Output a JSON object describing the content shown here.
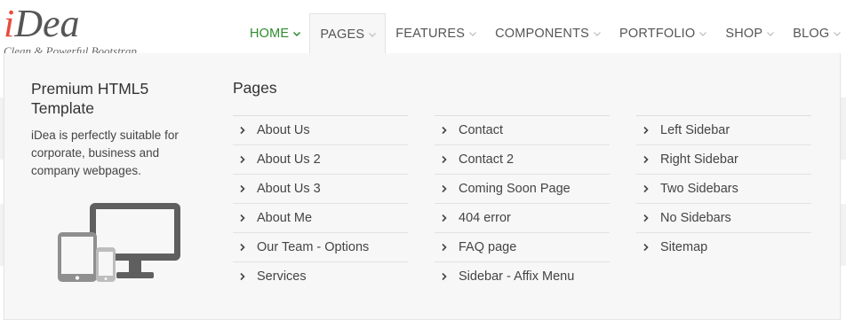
{
  "header": {
    "logo_first": "i",
    "logo_rest": "Dea",
    "tagline": "Clean & Powerful Bootstrap"
  },
  "nav": {
    "items": [
      {
        "label": "HOME"
      },
      {
        "label": "PAGES"
      },
      {
        "label": "FEATURES"
      },
      {
        "label": "COMPONENTS"
      },
      {
        "label": "PORTFOLIO"
      },
      {
        "label": "SHOP"
      },
      {
        "label": "BLOG"
      }
    ]
  },
  "dropdown": {
    "promo_title": "Premium HTML5 Template",
    "promo_text": "iDea is perfectly suitable for corporate, business and company webpages.",
    "promo_icon": "devices-icon",
    "section_title": "Pages",
    "columns": [
      {
        "items": [
          "About Us",
          "About Us 2",
          "About Us 3",
          "About Me",
          "Our Team - Options",
          "Services"
        ]
      },
      {
        "items": [
          "Contact",
          "Contact 2",
          "Coming Soon Page",
          "404 error",
          "FAQ page",
          "Sidebar - Affix Menu"
        ]
      },
      {
        "items": [
          "Left Sidebar",
          "Right Sidebar",
          "Two Sidebars",
          "No Sidebars",
          "Sitemap"
        ]
      }
    ]
  },
  "colors": {
    "brand_red": "#e84c3d",
    "active_green": "#2e8b2e",
    "panel_bg": "#f7f7f7"
  }
}
